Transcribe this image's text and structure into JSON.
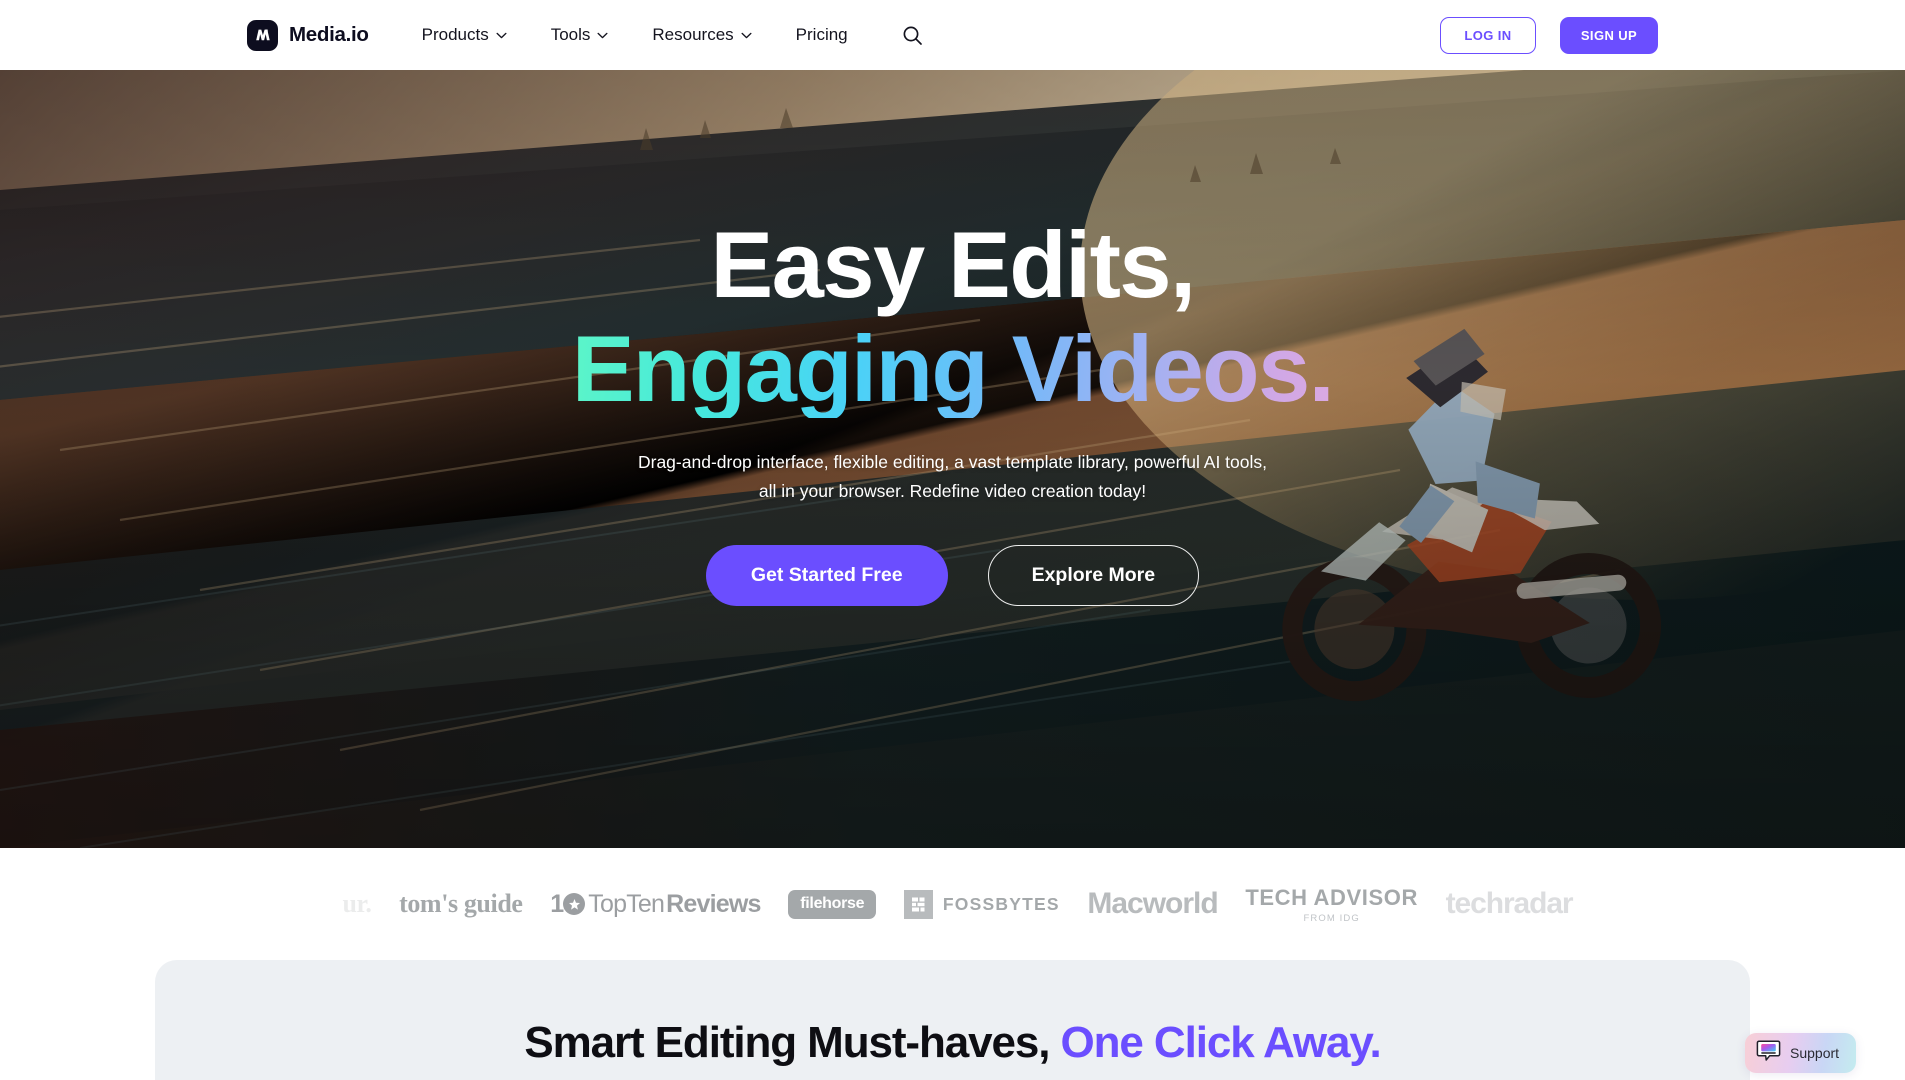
{
  "brand": {
    "name": "Media.io",
    "logo_icon": "media-io-monogram-icon",
    "accent_color": "#6b4eff",
    "logo_bg": "#0d0d1f"
  },
  "header": {
    "nav": [
      {
        "label": "Products",
        "has_chevron": true,
        "icon": "chevron-down-icon"
      },
      {
        "label": "Tools",
        "has_chevron": true,
        "icon": "chevron-down-icon"
      },
      {
        "label": "Resources",
        "has_chevron": true,
        "icon": "chevron-down-icon"
      },
      {
        "label": "Pricing",
        "has_chevron": false,
        "icon": ""
      }
    ],
    "search_icon": "search-icon",
    "login_label": "LOG IN",
    "signup_label": "SIGN UP"
  },
  "hero": {
    "headline_line1": "Easy Edits,",
    "headline_line2": "Engaging Videos.",
    "headline_gradient": [
      "#5cf5c8",
      "#4ad2f7",
      "#74b9f8",
      "#dba9e2"
    ],
    "subtitle": "Drag-and-drop interface, flexible editing, a vast template library, powerful AI tools, all in your browser. Redefine video creation today!",
    "cta_primary": "Get Started Free",
    "cta_secondary": "Explore More",
    "background_description": "motorcyclist doing a wheelie on a dirt slope at sunset"
  },
  "press_logos": [
    {
      "name": "partial-left-logo",
      "text": "ur.",
      "style": "fade-left"
    },
    {
      "name": "toms-guide",
      "text": "tom's guide",
      "style": "toms"
    },
    {
      "name": "toptenreviews",
      "text_prefix": "1",
      "badge": "star-icon",
      "text_a": "TopTen",
      "text_b": "Reviews",
      "style": "ttr"
    },
    {
      "name": "filehorse",
      "text": "filehorse",
      "style": "filehorse"
    },
    {
      "name": "fossbytes",
      "text": "FOSSBYTES",
      "icon": "fossbytes-square-icon",
      "style": "fossbytes"
    },
    {
      "name": "macworld",
      "text": "Macworld",
      "style": "macworld"
    },
    {
      "name": "tech-advisor",
      "text": "TECH ADVISOR",
      "subtext": "FROM IDG",
      "style": "techadvisor"
    },
    {
      "name": "techradar",
      "text": "techradar",
      "style": "fade-right"
    }
  ],
  "section": {
    "title_plain": "Smart Editing Must-haves, ",
    "title_accent": "One Click Away.",
    "panel_color": "#edf0f3"
  },
  "support": {
    "label": "Support",
    "icon": "chat-bubble-icon"
  }
}
